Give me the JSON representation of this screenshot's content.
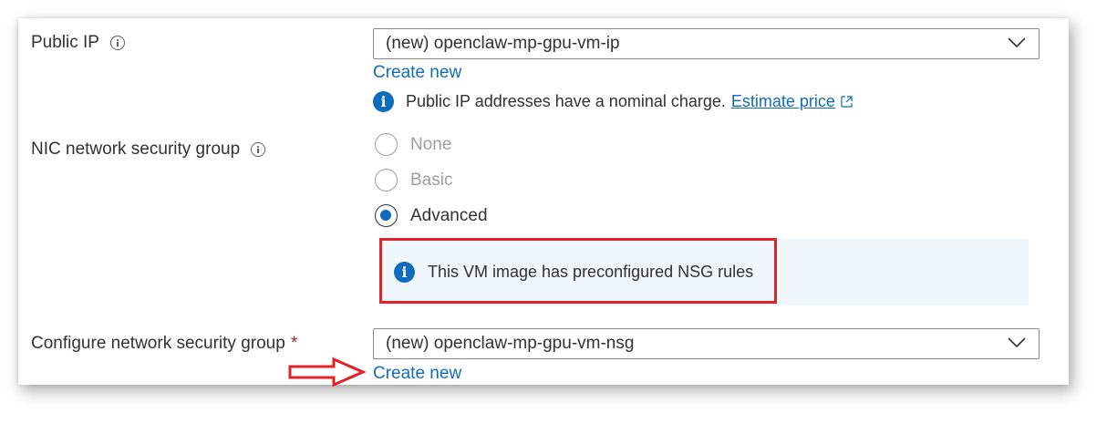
{
  "public_ip": {
    "label": "Public IP",
    "dropdown_value": "(new) openclaw-mp-gpu-vm-ip",
    "create_new_label": "Create new",
    "info_text": "Public IP addresses have a nominal charge.",
    "estimate_link": "Estimate price"
  },
  "nic_nsg": {
    "label": "NIC network security group",
    "options": [
      {
        "label": "None",
        "selected": false,
        "enabled": false
      },
      {
        "label": "Basic",
        "selected": false,
        "enabled": false
      },
      {
        "label": "Advanced",
        "selected": true,
        "enabled": true
      }
    ],
    "message": "This VM image has preconfigured NSG rules"
  },
  "configure_nsg": {
    "label": "Configure network security group",
    "required_marker": "*",
    "dropdown_value": "(new) openclaw-mp-gpu-vm-nsg",
    "create_new_label": "Create new"
  },
  "colors": {
    "link": "#0f6cbd",
    "annotation": "#e0222a",
    "message_background": "#eff6fc"
  },
  "icons": [
    "info-outline-icon",
    "chevron-down-icon",
    "info-filled-icon",
    "external-link-icon",
    "annotation-arrow-icon"
  ]
}
